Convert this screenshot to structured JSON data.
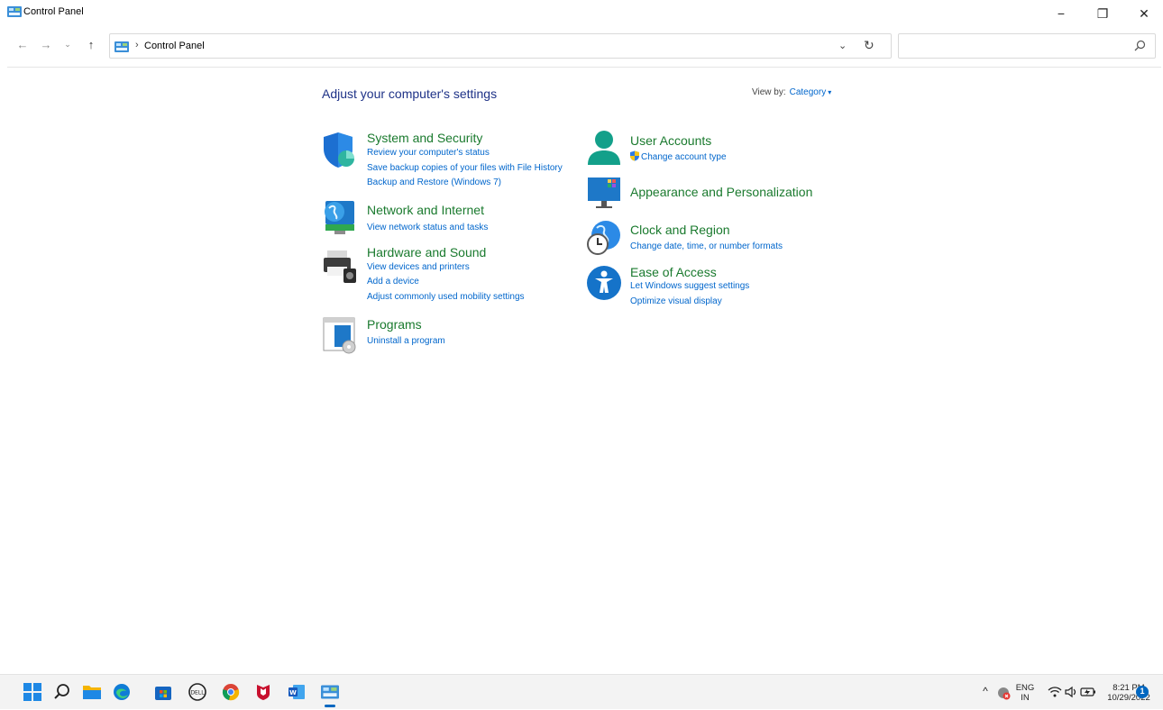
{
  "window": {
    "title": "Control Panel",
    "minimize": "−",
    "maximize": "❐",
    "close": "✕"
  },
  "nav": {
    "back": "←",
    "forward": "→",
    "recent": "⌄",
    "up": "↑",
    "breadcrumb_sep": "›",
    "breadcrumb": "Control Panel",
    "dropdown": "⌄",
    "refresh": "↻",
    "search_placeholder": ""
  },
  "content": {
    "heading": "Adjust your computer's settings",
    "view_by_label": "View by:",
    "view_by_value": "Category",
    "view_by_caret": "▾",
    "left_categories": [
      {
        "title": "System and Security",
        "links": [
          "Review your computer's status",
          "Save backup copies of your files with File History",
          "Backup and Restore (Windows 7)"
        ]
      },
      {
        "title": "Network and Internet",
        "links": [
          "View network status and tasks"
        ]
      },
      {
        "title": "Hardware and Sound",
        "links": [
          "View devices and printers",
          "Add a device",
          "Adjust commonly used mobility settings"
        ]
      },
      {
        "title": "Programs",
        "links": [
          "Uninstall a program"
        ]
      }
    ],
    "right_categories": [
      {
        "title": "User Accounts",
        "links": [
          "Change account type"
        ]
      },
      {
        "title": "Appearance and Personalization",
        "links": []
      },
      {
        "title": "Clock and Region",
        "links": [
          "Change date, time, or number formats"
        ]
      },
      {
        "title": "Ease of Access",
        "links": [
          "Let Windows suggest settings",
          "Optimize visual display"
        ]
      }
    ]
  },
  "taskbar": {
    "apps": [
      "start-icon",
      "search-icon",
      "file-explorer-icon",
      "edge-icon",
      "store-icon",
      "dell-icon",
      "chrome-icon",
      "mcafee-icon",
      "word-icon",
      "control-panel-icon"
    ],
    "tray": {
      "chevron": "^",
      "lang_top": "ENG",
      "lang_bottom": "IN",
      "time": "8:21 PM",
      "date": "10/29/2022",
      "notification_count": "1"
    }
  },
  "colors": {
    "category_title": "#1a7a2e",
    "link": "#0066cc",
    "heading": "#1e3287"
  }
}
